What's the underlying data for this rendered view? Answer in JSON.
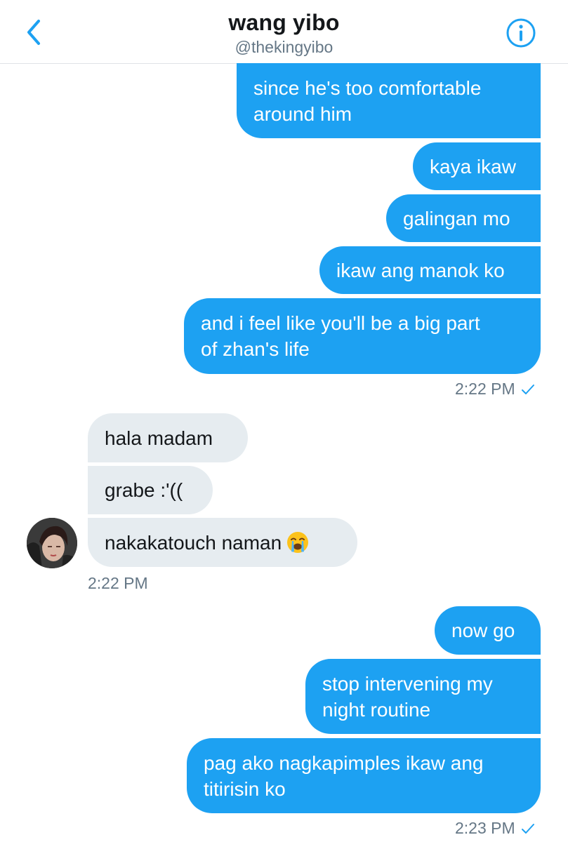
{
  "header": {
    "title": "wang yibo",
    "handle": "@thekingyibo",
    "back_icon": "chevron-left-icon",
    "info_icon": "info-icon"
  },
  "colors": {
    "accent": "#1da1f2",
    "incoming_bubble": "#e6ecf0",
    "meta_text": "#657786"
  },
  "messages": {
    "group1": [
      {
        "line1": "since he's too comfortable",
        "line2": "around him"
      },
      {
        "text": "kaya ikaw"
      },
      {
        "text": "galingan mo"
      },
      {
        "text": "ikaw ang manok ko"
      },
      {
        "line1": "and i feel like you'll be a big part",
        "line2": "of zhan's life"
      }
    ],
    "group1_time": "2:22 PM",
    "group2": [
      {
        "text": "hala madam"
      },
      {
        "text": "grabe :'(("
      },
      {
        "text": "nakakatouch naman",
        "emoji": "loudly-crying-face"
      }
    ],
    "group2_time": "2:22 PM",
    "group3": [
      {
        "text": "now go"
      },
      {
        "line1": "stop intervening my",
        "line2": "night routine"
      },
      {
        "line1": "pag ako nagkapimples ikaw ang",
        "line2": "titirisin ko"
      }
    ],
    "group3_time": "2:23 PM"
  }
}
